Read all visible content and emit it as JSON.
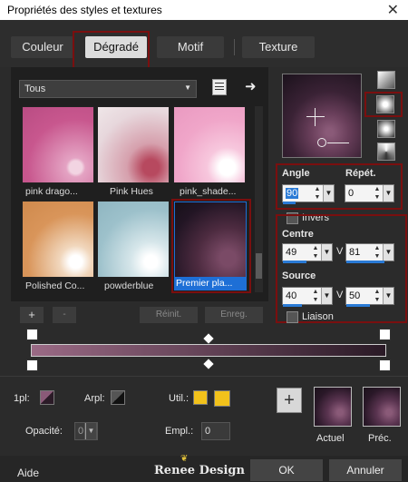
{
  "window": {
    "title": "Propriétés des styles et textures",
    "close": "✕"
  },
  "tabs": [
    {
      "label": "Couleur"
    },
    {
      "label": "Dégradé"
    },
    {
      "label": "Motif"
    },
    {
      "label": "Texture"
    }
  ],
  "category_dropdown": {
    "value": "Tous"
  },
  "thumbnails": [
    {
      "label": "pink drago..."
    },
    {
      "label": "Pink Hues"
    },
    {
      "label": "pink_shade..."
    },
    {
      "label": "Polished Co..."
    },
    {
      "label": "powderblue"
    },
    {
      "label": "Premier pla..."
    }
  ],
  "angle": {
    "label": "Angle",
    "value": "90"
  },
  "repeat": {
    "label": "Répét.",
    "value": "0"
  },
  "invert": {
    "label": "Invers"
  },
  "center": {
    "label": "Centre",
    "h": "49",
    "v_label": "V",
    "v": "81"
  },
  "source": {
    "label": "Source",
    "h": "40",
    "v_label": "V",
    "v": "50"
  },
  "link": {
    "label": "Liaison"
  },
  "buttons": {
    "plus": "+",
    "minus": "-",
    "reset": "Réinit.",
    "save": "Enreg."
  },
  "bottom": {
    "opl_label": "1pl:",
    "arpl_label": "Arpl:",
    "util_label": "Util.:",
    "opacity_label": "Opacité:",
    "opacity_value": "0",
    "empl_label": "Empl.:",
    "empl_value": "0",
    "current_label": "Actuel",
    "previous_label": "Préc."
  },
  "footer": {
    "help": "Aide",
    "logo": "Renee Design",
    "ok": "OK",
    "cancel": "Annuler"
  },
  "colors": {
    "accent": "#2a7ad5",
    "highlight_border": "#7a0f0f",
    "swatch_yellow": "#f2c21b"
  }
}
